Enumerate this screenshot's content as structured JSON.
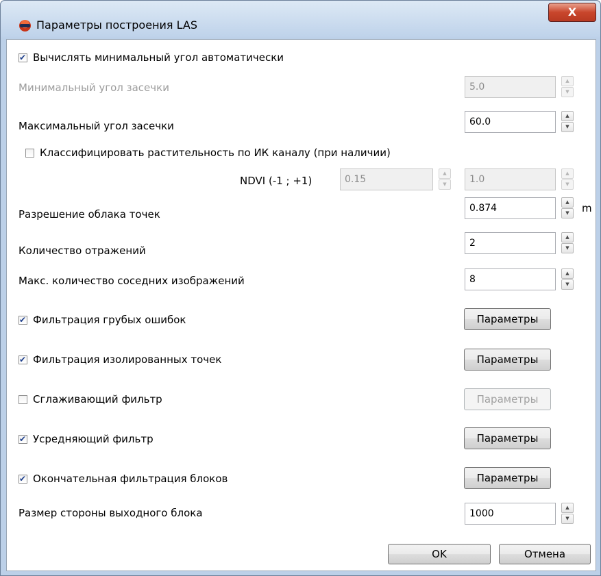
{
  "window": {
    "title": "Параметры построения LAS",
    "close_glyph": "X",
    "icon": "stereo-glasses-icon"
  },
  "form": {
    "auto_min_angle": {
      "label": "Вычислять минимальный угол автоматически",
      "checked": true
    },
    "min_angle": {
      "label": "Минимальный угол засечки",
      "value": "5.0",
      "enabled": false
    },
    "max_angle": {
      "label": "Максимальный угол засечки",
      "value": "60.0"
    },
    "classify_vegetation": {
      "label": "Классифицировать растительность по ИК каналу (при наличии)",
      "checked": false
    },
    "ndvi": {
      "label": "NDVI (-1 ; +1)",
      "from": "0.15",
      "to": "1.0",
      "enabled": false
    },
    "resolution": {
      "label": "Разрешение облака точек",
      "value": "0.874",
      "unit": "m"
    },
    "reflections": {
      "label": "Количество отражений",
      "value": "2"
    },
    "max_neighbors": {
      "label": "Макс. количество соседних изображений",
      "value": "8"
    },
    "filters": [
      {
        "label": "Фильтрация грубых ошибок",
        "checked": true,
        "button": "Параметры",
        "enabled": true
      },
      {
        "label": "Фильтрация изолированных точек",
        "checked": true,
        "button": "Параметры",
        "enabled": true
      },
      {
        "label": "Сглаживающий фильтр",
        "checked": false,
        "button": "Параметры",
        "enabled": false
      },
      {
        "label": "Усредняющий фильтр",
        "checked": true,
        "button": "Параметры",
        "enabled": true
      },
      {
        "label": "Окончательная фильтрация блоков",
        "checked": true,
        "button": "Параметры",
        "enabled": true
      }
    ],
    "block_size": {
      "label": "Размер стороны выходного блока",
      "value": "1000"
    }
  },
  "footer": {
    "ok_label": "OK",
    "cancel_label": "Отмена"
  }
}
